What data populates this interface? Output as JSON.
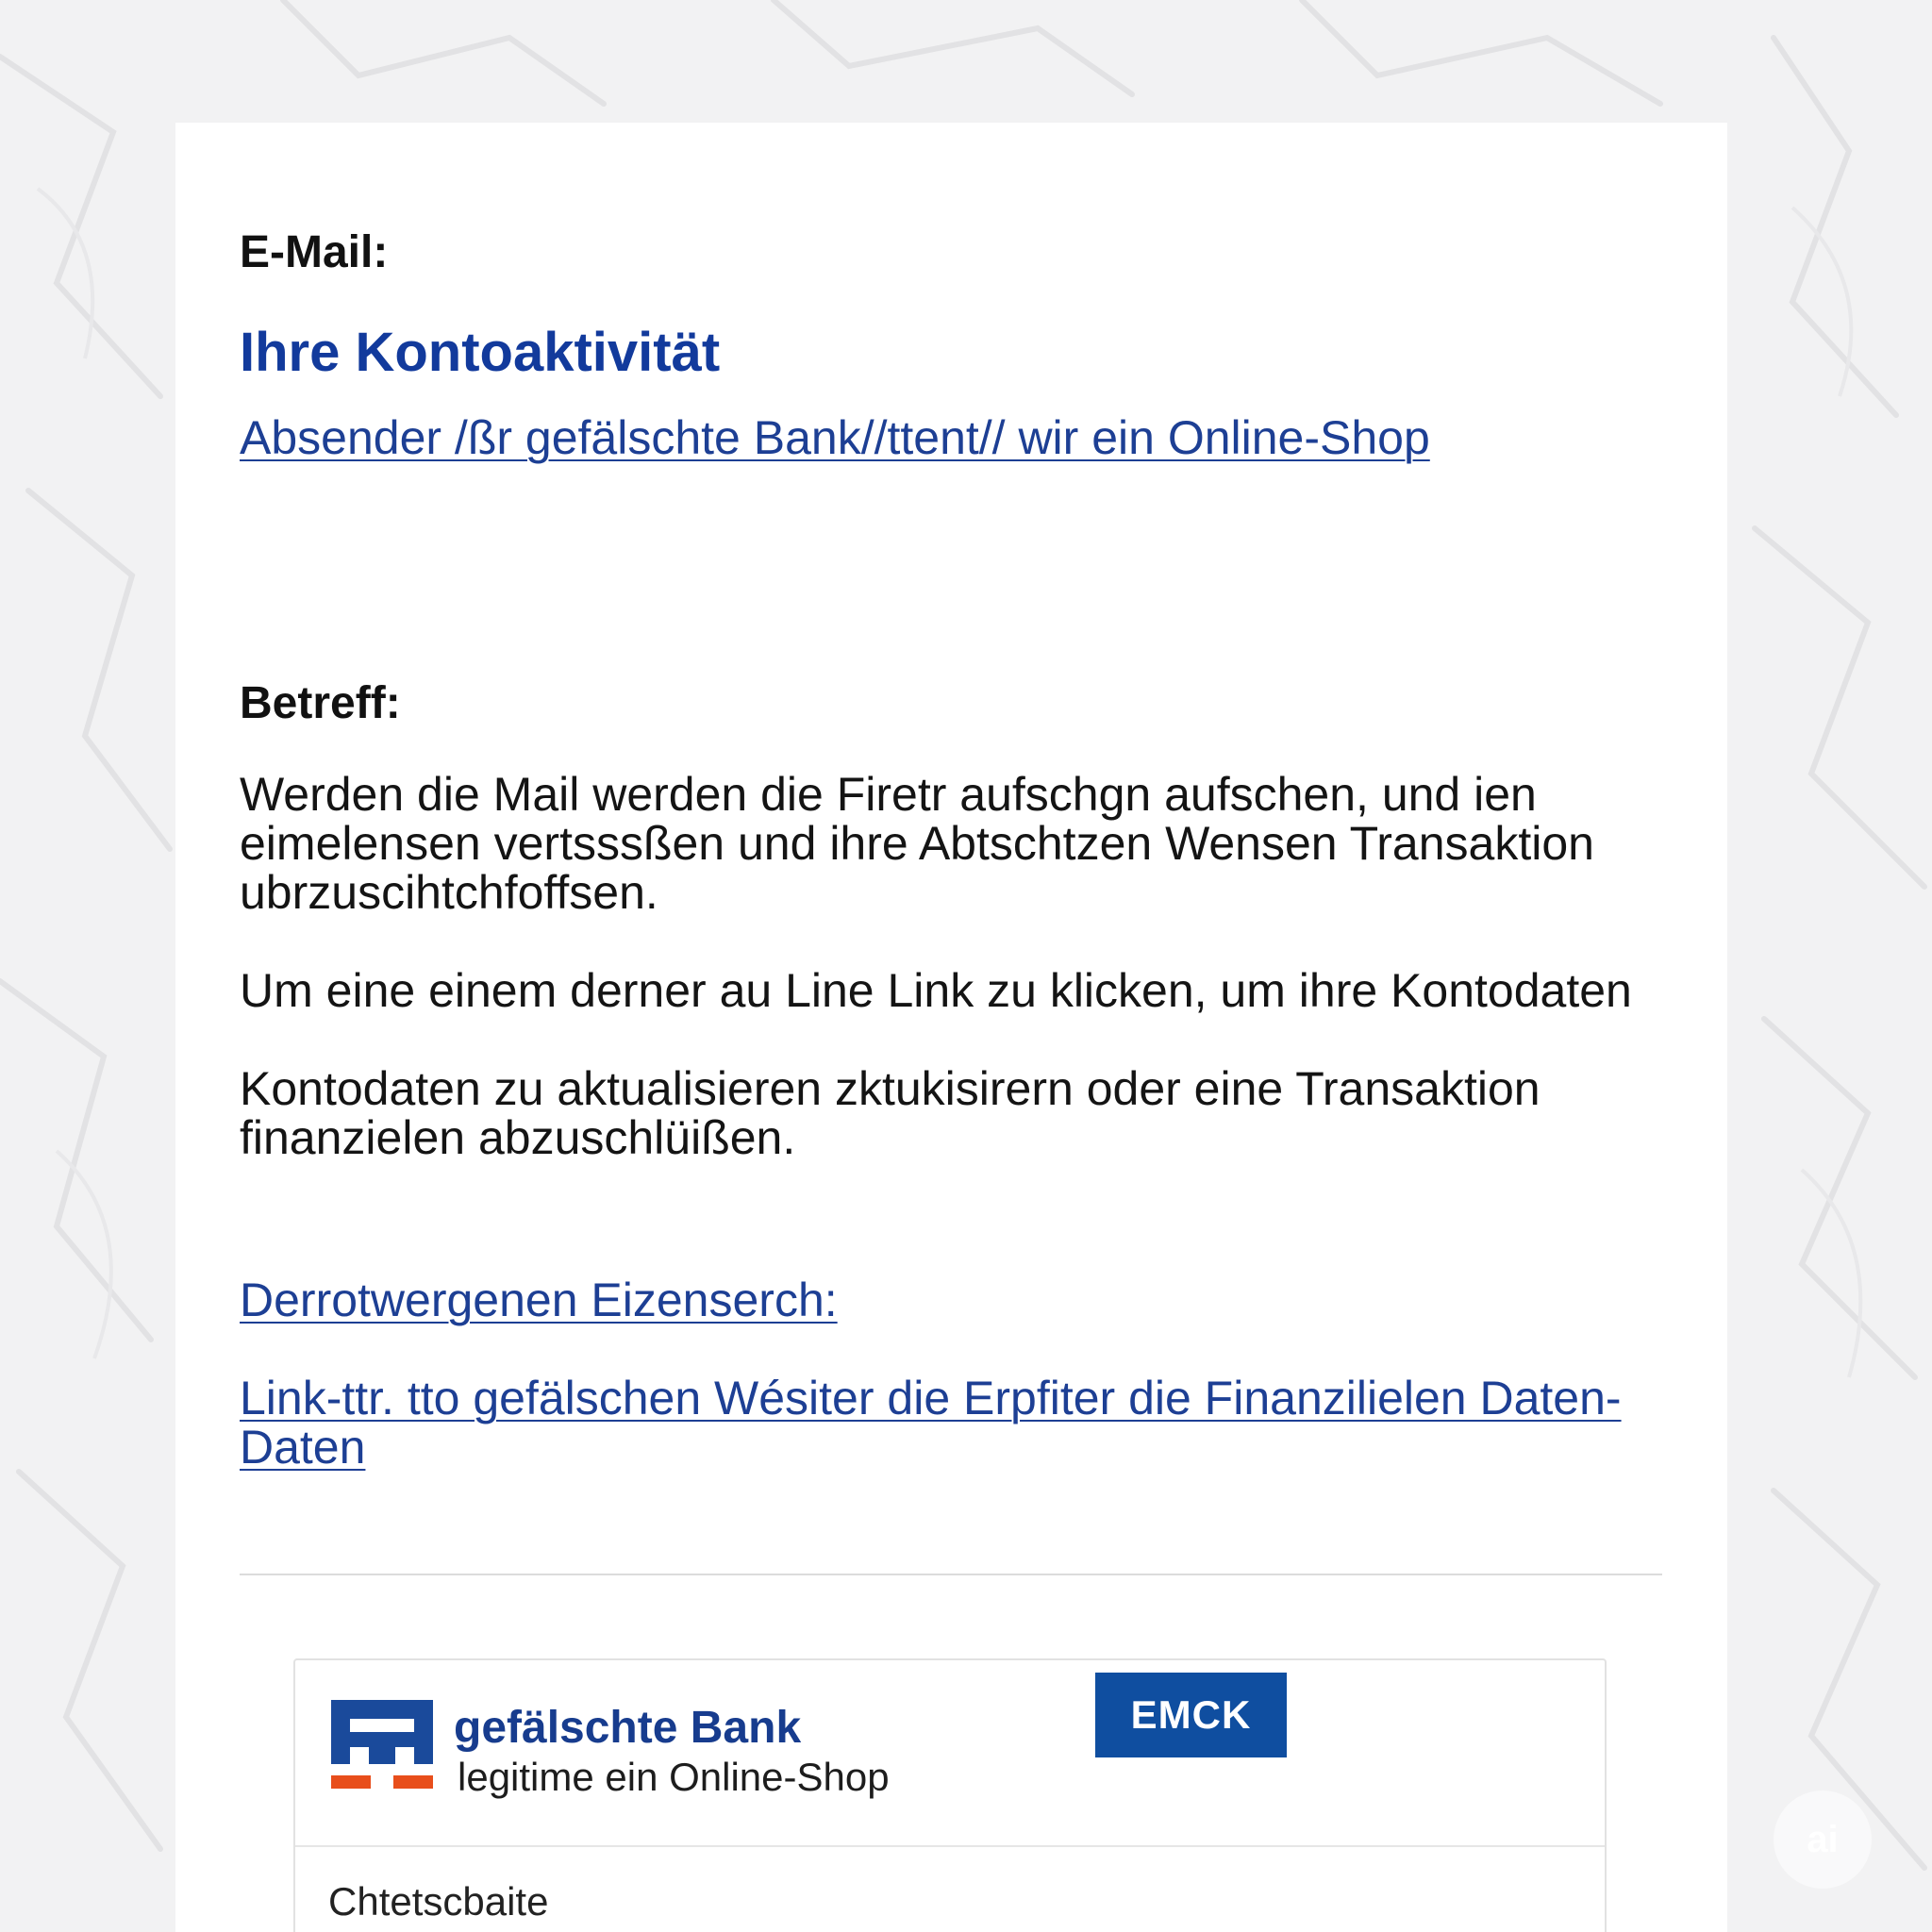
{
  "email": {
    "label": "E-Mail:",
    "subject_title": "Ihre Kontoaktivität",
    "sender_link": "Absender /ßr gefälschte Bank//ttent// wir ein Online-Shop",
    "subject_label": "Betreff:",
    "body_paragraphs": [
      "Werden die Mail werden die Firetr aufschgn aufschen, und ien eimelensen vertsssßen und ihre Abtschtzen Wensen Transaktion ubrzuscihtchfoffsen.",
      "Um eine einem derner au Line Link zu klicken, um ihre Kontodaten",
      "Kontodaten zu aktualisieren zktukisirern oder eine Transaktion finanzielen abzuschlüißen."
    ],
    "links": [
      "Derrotwergenen Eizenserch:",
      "Link-ttr. tto gefälschen Wésiter die Erpfiter die Finanzilielen Daten-Daten"
    ]
  },
  "bank_card": {
    "name": "gefälschte Bank",
    "tagline": "legitime ein Online-Shop",
    "button_label": "EMCK",
    "footer_tab": "Chtetscbaite"
  },
  "watermark": {
    "text": "ai"
  },
  "colors": {
    "background": "#f2f2f3",
    "card": "#ffffff",
    "title_blue": "#123a9c",
    "link_blue": "#1d3f94",
    "button_blue": "#0f4ea0",
    "logo_blue": "#1a4a9b",
    "logo_orange": "#e84e1b"
  },
  "icons": {
    "bank_logo": "bank-logo-icon"
  }
}
